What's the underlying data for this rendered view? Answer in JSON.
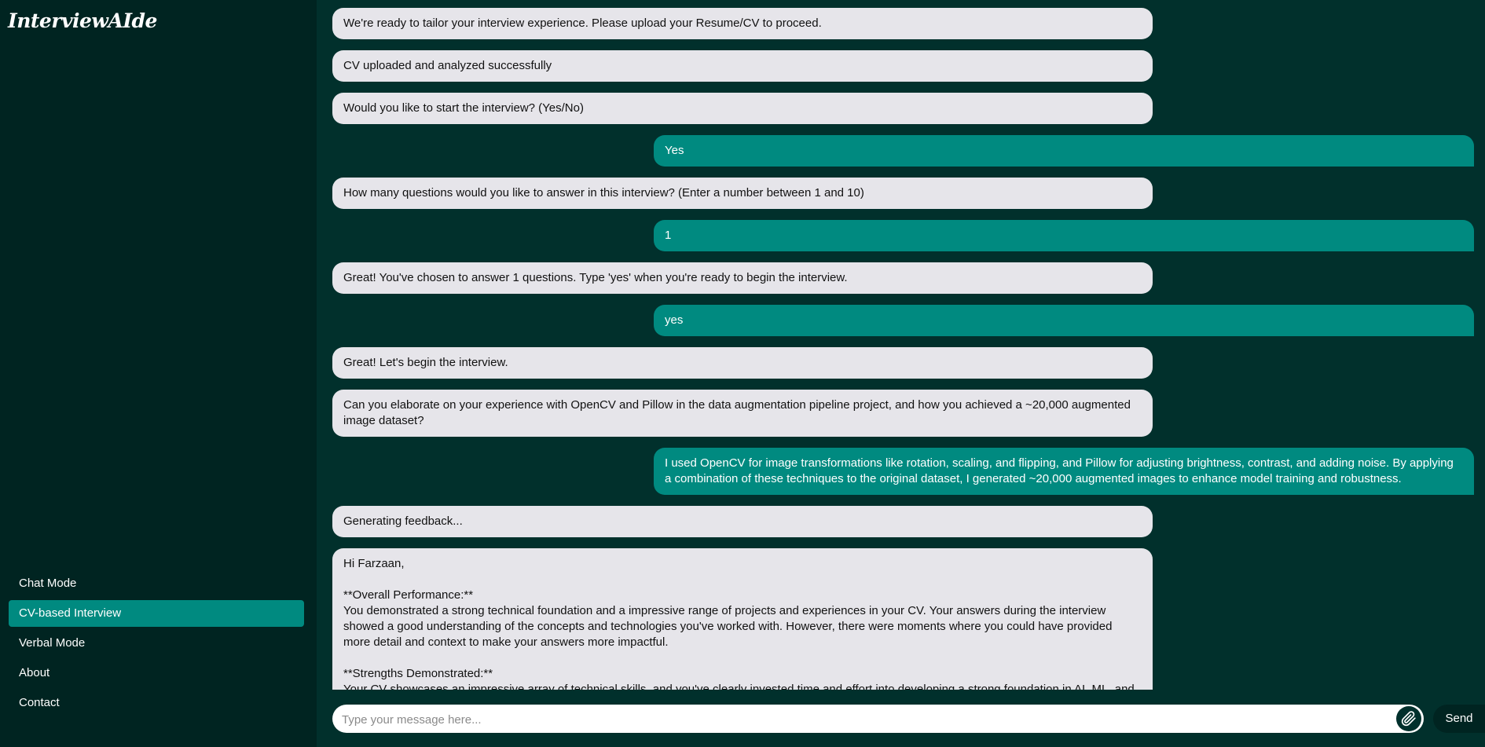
{
  "app": {
    "logo": "InterviewAIde"
  },
  "sidebar": {
    "items": [
      {
        "label": "Chat Mode",
        "active": false
      },
      {
        "label": "CV-based Interview",
        "active": true
      },
      {
        "label": "Verbal Mode",
        "active": false
      },
      {
        "label": "About",
        "active": false
      },
      {
        "label": "Contact",
        "active": false
      }
    ]
  },
  "messages": [
    {
      "role": "bot",
      "text": "We're ready to tailor your interview experience. Please upload your Resume/CV to proceed."
    },
    {
      "role": "bot",
      "text": "CV uploaded and analyzed successfully"
    },
    {
      "role": "bot",
      "text": "Would you like to start the interview? (Yes/No)"
    },
    {
      "role": "user",
      "text": "Yes"
    },
    {
      "role": "bot",
      "text": "How many questions would you like to answer in this interview? (Enter a number between 1 and 10)"
    },
    {
      "role": "user",
      "text": "1"
    },
    {
      "role": "bot",
      "text": "Great! You've chosen to answer 1 questions. Type 'yes' when you're ready to begin the interview."
    },
    {
      "role": "user",
      "text": "yes"
    },
    {
      "role": "bot",
      "text": "Great! Let's begin the interview."
    },
    {
      "role": "bot",
      "text": "Can you elaborate on your experience with OpenCV and Pillow in the data augmentation pipeline project, and how you achieved a ~20,000 augmented image dataset?"
    },
    {
      "role": "user",
      "text": "I used OpenCV for image transformations like rotation, scaling, and flipping, and Pillow for adjusting brightness, contrast, and adding noise. By applying a combination of these techniques to the original dataset, I generated ~20,000 augmented images to enhance model training and robustness."
    },
    {
      "role": "bot",
      "text": "Generating feedback..."
    },
    {
      "role": "bot",
      "text": "Hi Farzaan,\n\n**Overall Performance:**\nYou demonstrated a strong technical foundation and a impressive range of projects and experiences in your CV. Your answers during the interview showed a good understanding of the concepts and technologies you've worked with. However, there were moments where you could have provided more detail and context to make your answers more impactful.\n\n**Strengths Demonstrated:**\nYour CV showcases an impressive array of technical skills, and you've clearly invested time and effort into developing a strong foundation in AI, ML, and web development. Your projects, such as InterviewAIde and Academic Management Portal, demonstrate your ability to apply your skills to real-world problems and"
    }
  ],
  "composer": {
    "placeholder": "Type your message here...",
    "send_label": "Send",
    "attach_icon": "paperclip-icon"
  },
  "colors": {
    "background": "#01302c",
    "sidebar": "#002421",
    "accent": "#008a80",
    "bot_bubble": "#e6e5ea"
  }
}
